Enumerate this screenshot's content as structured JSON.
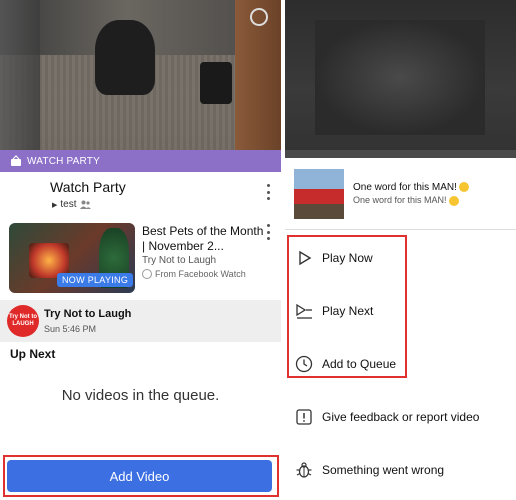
{
  "left": {
    "watch_party_bar": "WATCH PARTY",
    "header": {
      "title": "Watch Party",
      "subtitle": "test"
    },
    "now_playing": {
      "title": "Best Pets of the Month | November 2...",
      "channel": "Try Not to Laugh",
      "source": "From Facebook Watch",
      "badge": "NOW PLAYING"
    },
    "next_item": {
      "title": "Try Not to Laugh",
      "time": "Sun 5:46 PM",
      "logo_text": "Try Not to LAUGH"
    },
    "up_next_heading": "Up Next",
    "empty_queue": "No videos in the queue.",
    "add_video_button": "Add Video"
  },
  "right": {
    "video_title_1": "One word for this MAN!",
    "video_title_2": "One word for this MAN!",
    "menu": [
      {
        "label": "Play Now",
        "icon": "play-icon"
      },
      {
        "label": "Play Next",
        "icon": "play-next-icon"
      },
      {
        "label": "Add to Queue",
        "icon": "clock-icon"
      },
      {
        "label": "Give feedback or report video",
        "icon": "report-icon"
      },
      {
        "label": "Something went wrong",
        "icon": "bug-icon"
      }
    ]
  },
  "colors": {
    "watch_party": "#8c6fc7",
    "accent_blue": "#3b6fe2",
    "highlight_red": "#e0302f"
  }
}
